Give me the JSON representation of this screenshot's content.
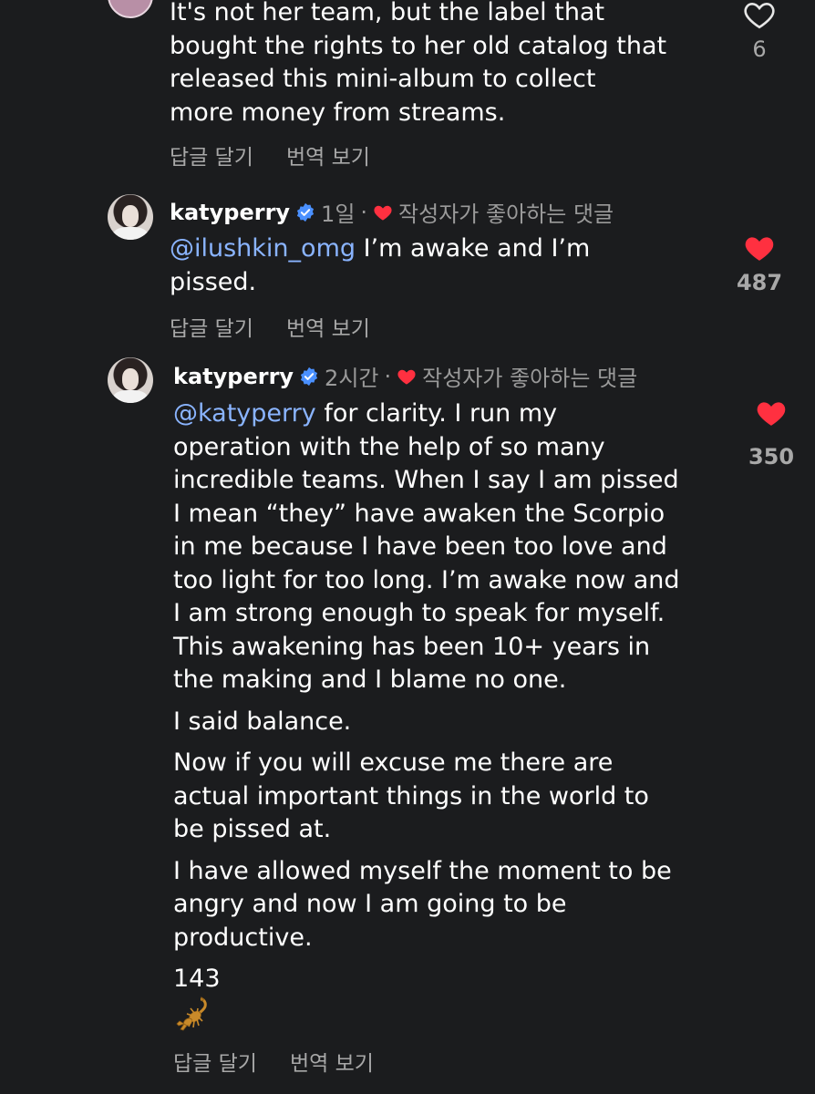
{
  "comments": [
    {
      "username": "",
      "body": [
        "It's not her team, but the label that",
        "bought the rights to her old catalog that",
        "released this mini-album to collect",
        "more money from streams."
      ],
      "reply_label": "답글 달기",
      "translate_label": "번역 보기",
      "likes": "6",
      "liked": false
    },
    {
      "username": "katyperry",
      "time": "1일",
      "liked_by_creator": "작성자가 좋아하는 댓글",
      "mention": "@ilushkin_omg",
      "body_after_mention": " I’m awake and I’m",
      "body": [
        "pissed."
      ],
      "reply_label": "답글 달기",
      "translate_label": "번역 보기",
      "likes": "487",
      "liked": true
    },
    {
      "username": "katyperry",
      "time": "2시간",
      "liked_by_creator": "작성자가 좋아하는 댓글",
      "mention": "@katyperry",
      "body_after_mention": " for clarity. I run my",
      "para1": [
        "operation with the help of so many",
        "incredible teams. When I say I am pissed",
        "I mean “they” have awaken the Scorpio",
        "in me because I have been too love and",
        "too light for too long. I’m awake now and",
        "I am strong enough to speak for myself.",
        "This awakening has been 10+ years in",
        "the making and I blame no one."
      ],
      "para2": [
        "I said balance."
      ],
      "para3": [
        "Now if you will excuse me there are",
        "actual important things in the world to",
        "be pissed at."
      ],
      "para4": [
        "I have allowed myself the moment to be",
        "angry and now I am going to be",
        "productive."
      ],
      "para5": [
        "143"
      ],
      "emoji_name": "scorpion-emoji",
      "reply_label": "답글 달기",
      "translate_label": "번역 보기",
      "likes": "350",
      "liked": true
    }
  ],
  "colors": {
    "background": "#1b1c1e",
    "text": "#ffffff",
    "muted": "#a8a8a8",
    "mention": "#8ab4ff",
    "heart_red": "#ff3040",
    "verified_blue": "#4a90ff"
  }
}
